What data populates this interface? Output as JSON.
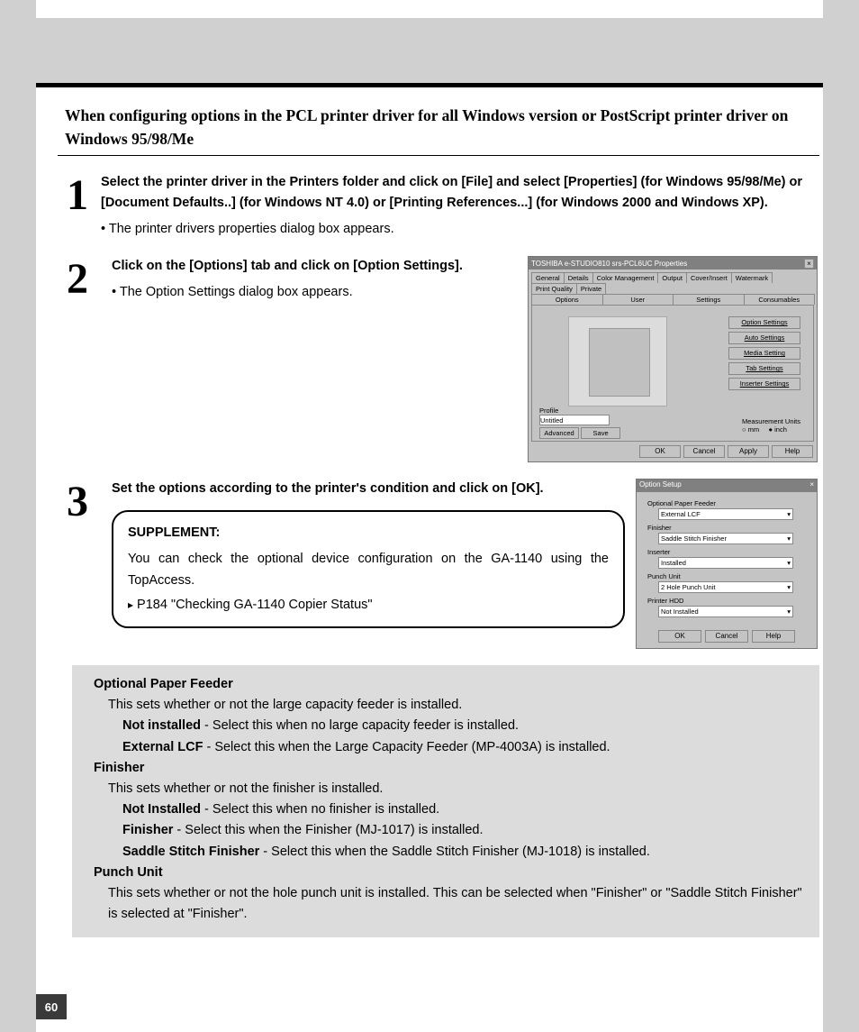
{
  "section_title": "When configuring options in the PCL printer driver for all Windows version or PostScript printer driver on Windows 95/98/Me",
  "step1": {
    "num": "1",
    "main": "Select the printer driver in the Printers folder and click on [File] and select [Properties] (for Windows 95/98/Me) or [Document Defaults..] (for Windows NT 4.0) or [Printing References...] (for Windows 2000 and Windows XP).",
    "bullet": "The printer drivers properties dialog box appears."
  },
  "step2": {
    "num": "2",
    "main": "Click on the [Options] tab and click on [Option Settings].",
    "bullet": "The Option Settings dialog box appears."
  },
  "step3": {
    "num": "3",
    "main": "Set the options according to the printer's condition and click on [OK]."
  },
  "dlg1": {
    "title": "TOSHIBA e-STUDIO810 srs-PCL6UC Properties",
    "tabs_row1": [
      "General",
      "Details",
      "Color Management",
      "Output",
      "Cover/Insert",
      "Watermark",
      "Print Quality",
      "Private"
    ],
    "tabs_row2": [
      "Options",
      "User",
      "Settings",
      "Consumables"
    ],
    "opt_buttons": [
      "Option Settings",
      "Auto Settings",
      "Media Setting",
      "Tab Settings",
      "Inserter Settings"
    ],
    "profile_label": "Profile",
    "profile_value": "Untitled",
    "profile_btns": [
      "Advanced",
      "Save"
    ],
    "measure_label": "Measurement Units",
    "measure_opts": [
      "mm",
      "inch"
    ],
    "btns": [
      "OK",
      "Cancel",
      "Apply",
      "Help"
    ]
  },
  "dlg2": {
    "title": "Option Setup",
    "rows": [
      {
        "label": "Optional Paper Feeder",
        "value": "External LCF"
      },
      {
        "label": "Finisher",
        "value": "Saddle Stitch Finisher"
      },
      {
        "label": "Inserter",
        "value": "Installed"
      },
      {
        "label": "Punch Unit",
        "value": "2 Hole Punch Unit"
      },
      {
        "label": "Printer HDD",
        "value": "Not Installed"
      }
    ],
    "btns": [
      "OK",
      "Cancel",
      "Help"
    ]
  },
  "supplement": {
    "hd": "SUPPLEMENT:",
    "body": "You can check the optional device configuration on the GA-1140 using the TopAccess.",
    "ref": "P184 \"Checking GA-1140 Copier Status\""
  },
  "graybox": {
    "s1": {
      "hdr": "Optional Paper Feeder",
      "desc": "This sets whether or not the large capacity feeder is installed.",
      "opts": [
        {
          "b": "Not installed",
          "t": " - Select this when no large capacity feeder is installed."
        },
        {
          "b": "External LCF",
          "t": " - Select this when the Large Capacity Feeder (MP-4003A) is installed."
        }
      ]
    },
    "s2": {
      "hdr": "Finisher",
      "desc": "This sets whether or not the finisher is installed.",
      "opts": [
        {
          "b": "Not Installed",
          "t": " - Select this when no finisher is installed."
        },
        {
          "b": "Finisher",
          "t": " - Select this when the Finisher (MJ-1017) is installed."
        },
        {
          "b": "Saddle Stitch Finisher",
          "t": " - Select this when the Saddle Stitch Finisher (MJ-1018) is installed."
        }
      ]
    },
    "s3": {
      "hdr": "Punch Unit",
      "desc": "This sets whether or not the hole punch unit is installed.  This can be selected when \"Finisher\" or \"Saddle Stitch Finisher\" is selected at \"Finisher\"."
    }
  },
  "page_number": "60"
}
